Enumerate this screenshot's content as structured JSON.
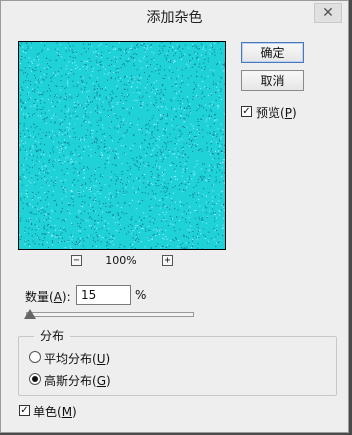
{
  "dialog": {
    "title": "添加杂色"
  },
  "titlebar": {
    "close_glyph": "✕"
  },
  "buttons": {
    "ok_label": "确定",
    "cancel_label": "取消"
  },
  "preview_toggle": {
    "label_pre": "预览(",
    "key": "P",
    "label_post": ")",
    "checked": true
  },
  "zoom": {
    "minus": "−",
    "plus": "+",
    "value": "100%"
  },
  "amount": {
    "label_pre": "数量(",
    "key": "A",
    "label_post": "):",
    "value": "15",
    "unit": "%",
    "slider_fraction": 0.0
  },
  "distribution": {
    "title": "分布",
    "options": [
      {
        "label_pre": "平均分布(",
        "key": "U",
        "label_post": ")",
        "selected": false
      },
      {
        "label_pre": "高斯分布(",
        "key": "G",
        "label_post": ")",
        "selected": true
      }
    ]
  },
  "monochrome": {
    "label_pre": "单色(",
    "key": "M",
    "label_post": ")",
    "checked": true
  },
  "colors": {
    "preview_base": "#1fd2d8",
    "noise_dark": "#0a6f86",
    "noise_light": "#a8f6ff"
  }
}
